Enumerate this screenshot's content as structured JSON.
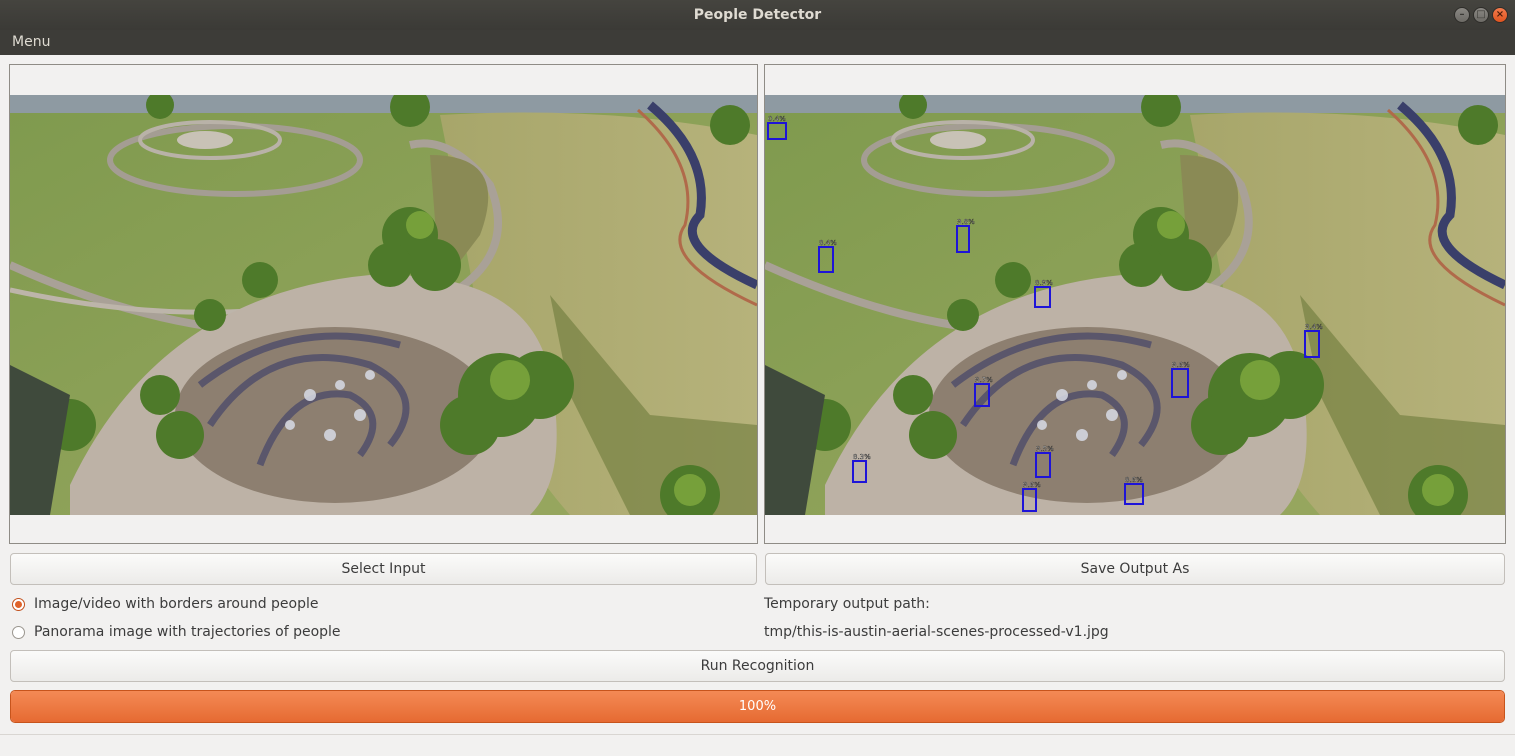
{
  "window": {
    "title": "People Detector"
  },
  "menubar": {
    "items": [
      "Menu"
    ]
  },
  "panels": {
    "input_image": "aerial-park-input",
    "output_image": "aerial-park-detections",
    "detections": [
      {
        "label": "0.4%"
      },
      {
        "label": "8.4%"
      },
      {
        "label": "9.8%"
      },
      {
        "label": "8.9%"
      },
      {
        "label": "9.4%"
      },
      {
        "label": "9.6%"
      },
      {
        "label": "9.7%"
      },
      {
        "label": "8.3%"
      },
      {
        "label": "9.5%"
      },
      {
        "label": "9.6%"
      },
      {
        "label": "8.6%"
      }
    ],
    "detection_box_color": "#1e14d8"
  },
  "buttons": {
    "select_input": "Select Input",
    "save_output": "Save Output As",
    "run": "Run Recognition"
  },
  "options": {
    "borders": {
      "label": "Image/video with borders around people",
      "checked": true
    },
    "panorama": {
      "label": "Panorama image with trajectories of people",
      "checked": false
    }
  },
  "output": {
    "heading": "Temporary output path:",
    "path": "tmp/this-is-austin-aerial-scenes-processed-v1.jpg"
  },
  "progress": {
    "value": 1.0,
    "label": "100%"
  },
  "colors": {
    "accent": "#e66a32",
    "titlebar": "#3d3c38"
  }
}
